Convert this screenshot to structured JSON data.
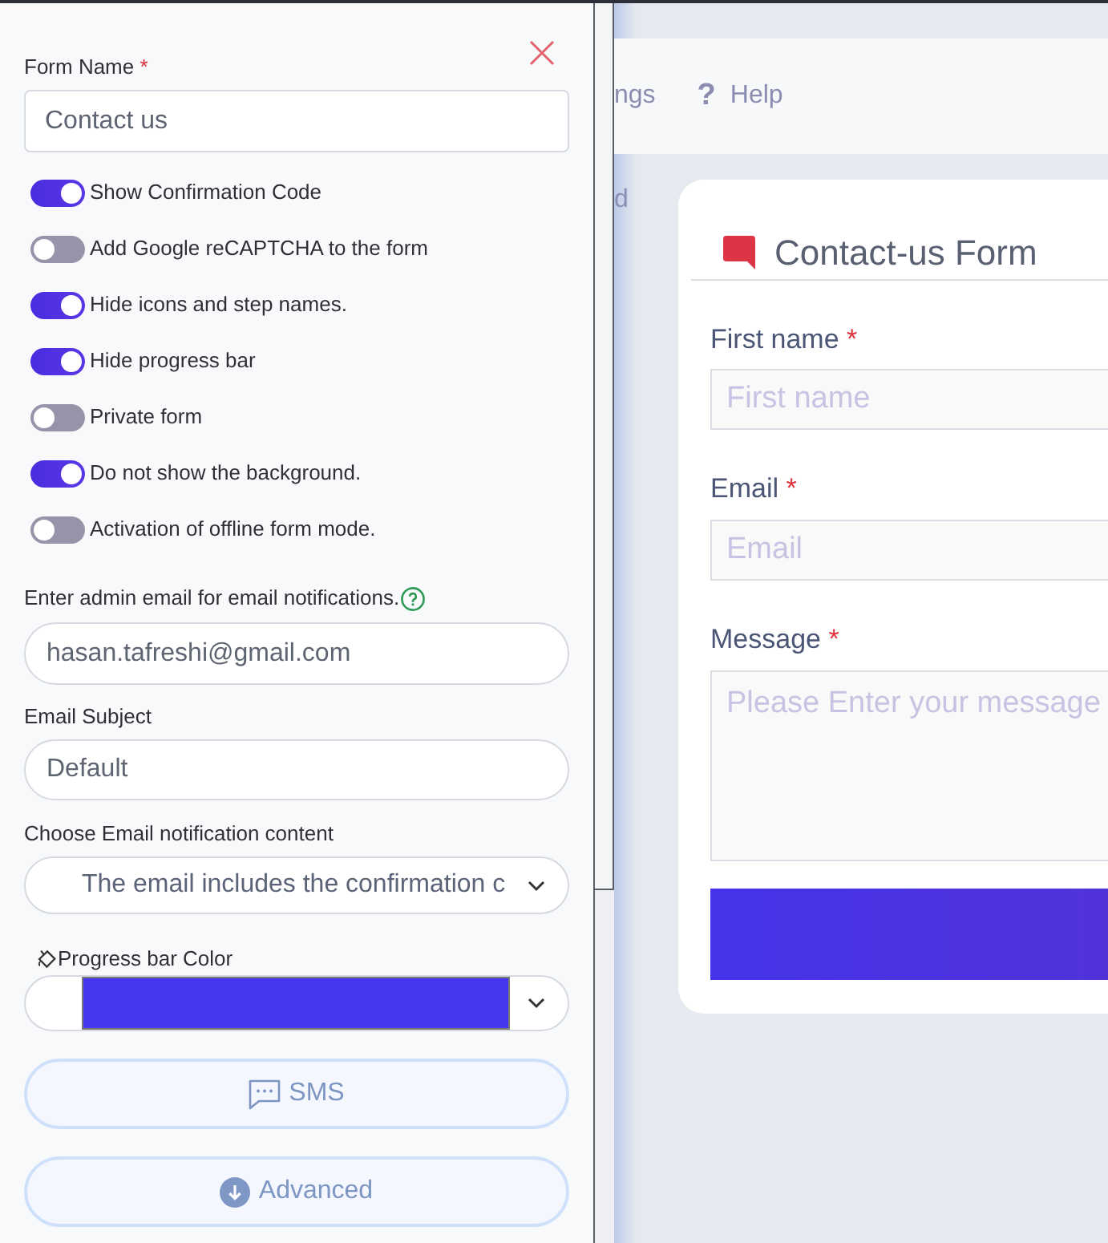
{
  "settings_panel": {
    "form_name": {
      "label": "Form Name",
      "required_mark": "*",
      "value": "Contact us"
    },
    "toggles": [
      {
        "label": "Show Confirmation Code",
        "on": true
      },
      {
        "label": "Add Google reCAPTCHA to the form",
        "on": false
      },
      {
        "label": "Hide icons and step names.",
        "on": true
      },
      {
        "label": "Hide progress bar",
        "on": true
      },
      {
        "label": "Private form",
        "on": false
      },
      {
        "label": "Do not show the background.",
        "on": true
      },
      {
        "label": "Activation of offline form mode.",
        "on": false
      }
    ],
    "admin_email": {
      "label": "Enter admin email for email notifications.",
      "value": "hasan.tafreshi@gmail.com"
    },
    "email_subject": {
      "label": "Email Subject",
      "value": "Default"
    },
    "notification_content": {
      "label": "Choose Email notification content",
      "value": "The email includes the confirmation c"
    },
    "progress_bar_color": {
      "label": "Progress bar Color",
      "color": "#4536f0"
    },
    "buttons": [
      {
        "kind": "sms",
        "label": "SMS"
      },
      {
        "kind": "advanced",
        "label": "Advanced"
      }
    ]
  },
  "top_bar": {
    "items": [
      {
        "label": "ngs"
      },
      {
        "icon": "?",
        "label": "Help"
      }
    ]
  },
  "side_menu": {
    "items": [
      {
        "label": "d"
      }
    ]
  },
  "form_card": {
    "title": "Contact-us Form",
    "fields": [
      {
        "kind": "input",
        "label": "First name",
        "required_mark": "*",
        "placeholder": "First name"
      },
      {
        "kind": "input",
        "label": "Email",
        "required_mark": "*",
        "placeholder": "Email"
      },
      {
        "kind": "textarea",
        "label": "Message",
        "required_mark": "*",
        "placeholder": "Please Enter your message"
      }
    ]
  }
}
